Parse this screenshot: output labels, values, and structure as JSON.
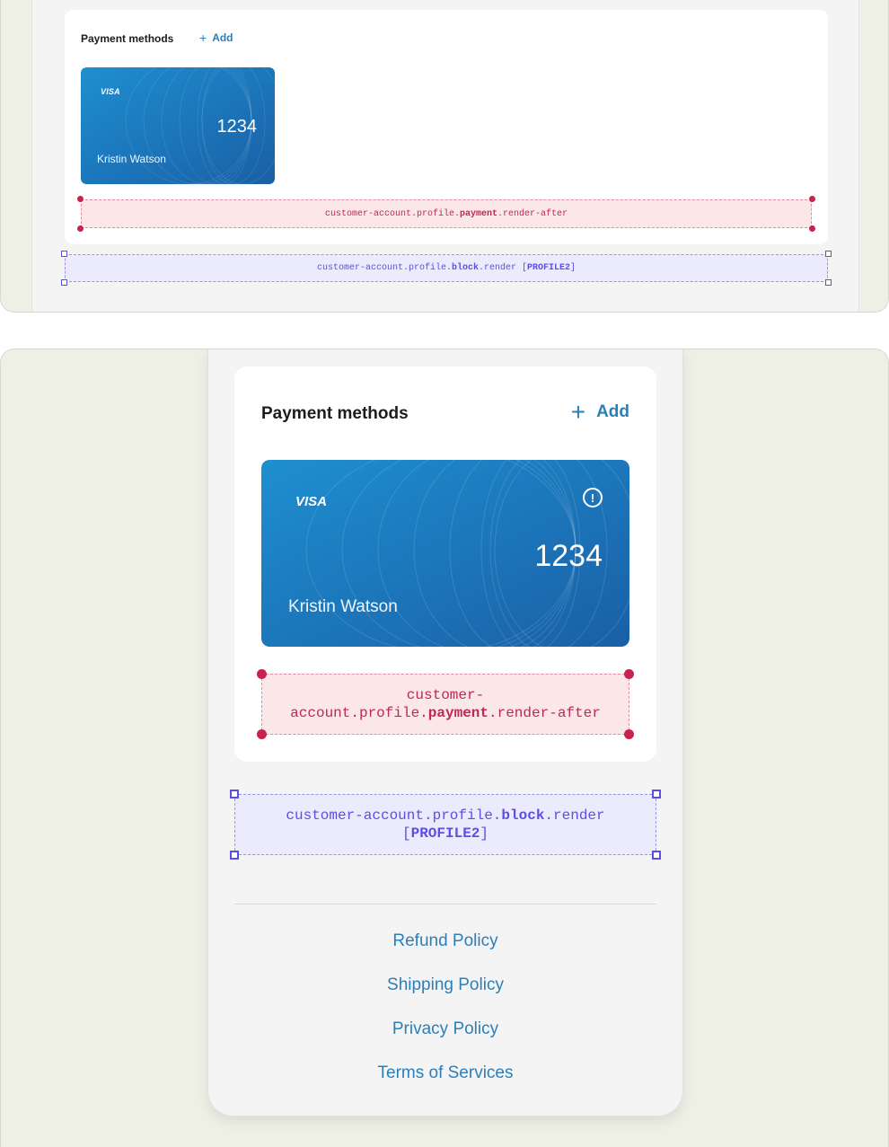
{
  "desktop": {
    "payment": {
      "title": "Payment methods",
      "add_icon": "+",
      "add_label": "Add",
      "card": {
        "brand": "VISA",
        "last4": "1234",
        "holder": "Kristin Watson"
      }
    },
    "ext_payment": {
      "pre": "customer-account.profile.",
      "bold": "payment",
      "post": ".render-after"
    },
    "ext_block": {
      "pre": "customer-account.profile.",
      "bold": "block",
      "post": ".render [",
      "tag": "PROFILE2",
      "end": "]"
    }
  },
  "mobile": {
    "payment": {
      "title": "Payment methods",
      "add_icon": "+",
      "add_label": "Add",
      "card": {
        "brand": "VISA",
        "last4": "1234",
        "holder": "Kristin Watson",
        "alert_icon": "!"
      }
    },
    "ext_payment": {
      "line1": "customer-",
      "pre": "account.profile.",
      "bold": "payment",
      "post": ".render-after"
    },
    "ext_block": {
      "line1_pre": "customer-account.profile.",
      "bold": "block",
      "line1_post": ".render",
      "open": "[",
      "tag": "PROFILE2",
      "close": "]"
    },
    "footer_links": [
      "Refund Policy",
      "Shipping Policy",
      "Privacy Policy",
      "Terms of Services"
    ]
  },
  "colors": {
    "link": "#2b7fb8",
    "card_gradient_start": "#1e8fd0",
    "card_gradient_end": "#1a5fa6",
    "ext_pink_text": "#c0284e",
    "ext_violet_text": "#5b4fe0",
    "frame_bg": "#eef0e6"
  },
  "icons": {
    "add": "plus-icon",
    "alert": "alert-circle-icon",
    "brand": "visa-logo"
  }
}
